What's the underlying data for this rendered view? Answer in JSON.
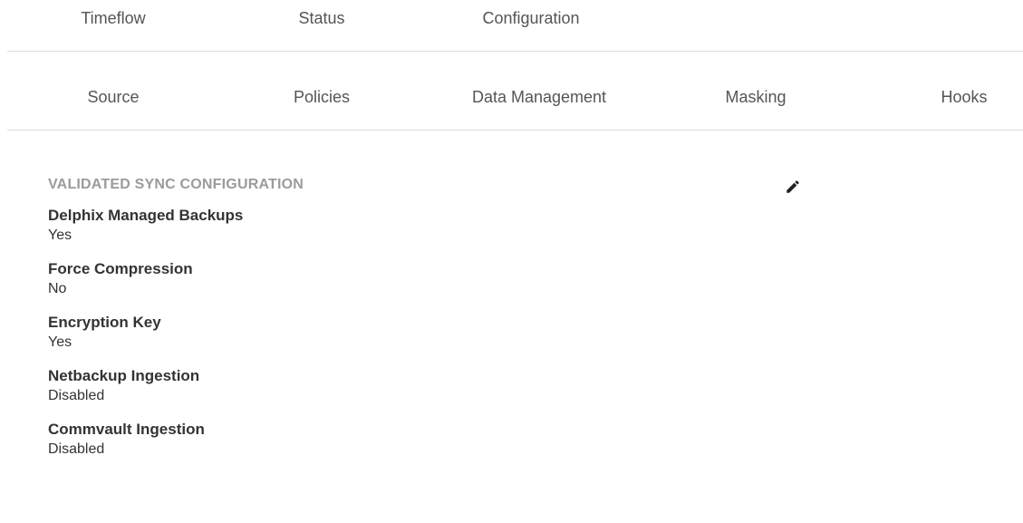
{
  "primary_tabs": [
    {
      "label": "Timeflow"
    },
    {
      "label": "Status"
    },
    {
      "label": "Configuration"
    }
  ],
  "secondary_tabs": [
    {
      "label": "Source"
    },
    {
      "label": "Policies"
    },
    {
      "label": "Data Management"
    },
    {
      "label": "Masking"
    },
    {
      "label": "Hooks"
    }
  ],
  "section": {
    "title": "VALIDATED SYNC CONFIGURATION",
    "edit_icon": "pencil-icon",
    "fields": [
      {
        "label": "Delphix Managed Backups",
        "value": "Yes"
      },
      {
        "label": "Force Compression",
        "value": "No"
      },
      {
        "label": "Encryption Key",
        "value": "Yes"
      },
      {
        "label": "Netbackup Ingestion",
        "value": "Disabled"
      },
      {
        "label": "Commvault Ingestion",
        "value": "Disabled"
      }
    ]
  }
}
